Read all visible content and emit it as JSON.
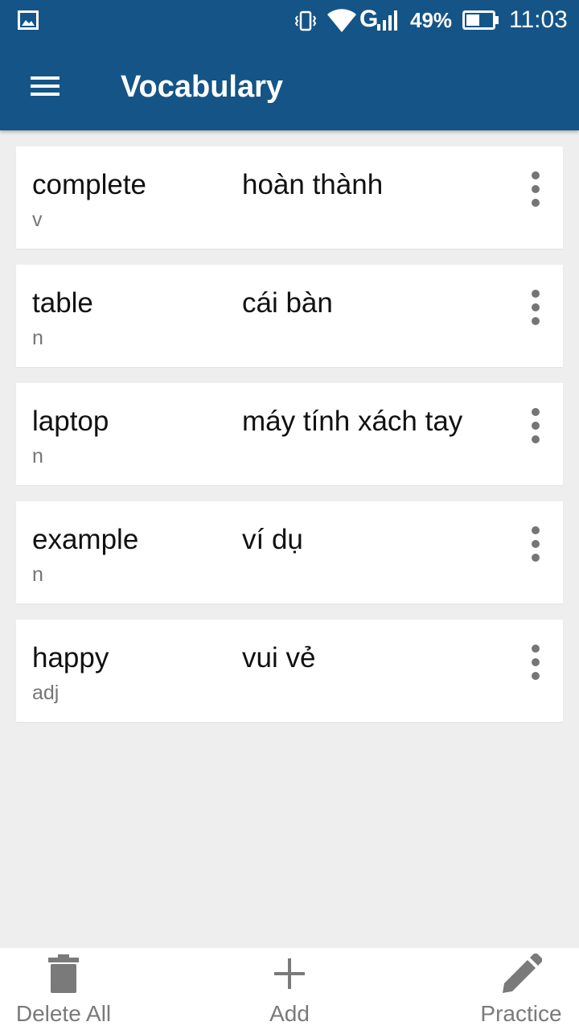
{
  "status_bar": {
    "network": "G",
    "battery": "49%",
    "time": "11:03"
  },
  "app_bar": {
    "title": "Vocabulary",
    "menu_icon": "menu-icon"
  },
  "words": [
    {
      "word": "complete",
      "pos": "v",
      "meaning": "hoàn thành"
    },
    {
      "word": "table",
      "pos": "n",
      "meaning": "cái bàn"
    },
    {
      "word": "laptop",
      "pos": "n",
      "meaning": "máy tính xách tay"
    },
    {
      "word": "example",
      "pos": "n",
      "meaning": "ví dụ"
    },
    {
      "word": "happy",
      "pos": "adj",
      "meaning": "vui vẻ"
    }
  ],
  "bottom_bar": {
    "delete_all": {
      "label": "Delete All",
      "icon": "trash-icon"
    },
    "add": {
      "label": "Add",
      "icon": "plus-icon"
    },
    "practice": {
      "label": "Practice",
      "icon": "pencil-icon"
    }
  },
  "colors": {
    "app_bar": "#155487",
    "background": "#eeeeee",
    "card": "#ffffff",
    "secondary_text": "#767676"
  }
}
